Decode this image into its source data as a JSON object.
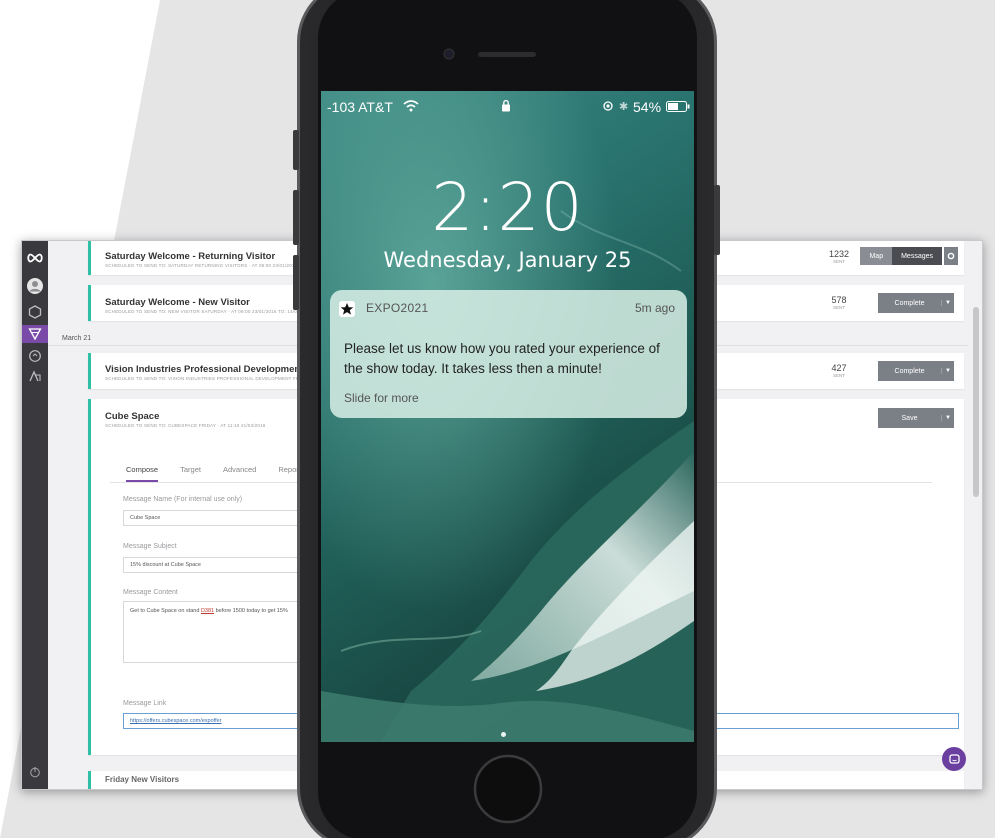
{
  "sidebar": {
    "logo_icon": "infinity-logo-icon",
    "items": [
      {
        "icon": "user-avatar-icon",
        "active": false
      },
      {
        "icon": "hexagon-icon",
        "active": false
      },
      {
        "icon": "triangle-filter-icon",
        "active": true
      },
      {
        "icon": "refresh-circle-icon",
        "active": false
      },
      {
        "icon": "people-icon",
        "active": false
      }
    ],
    "bottom_icon": "power-icon"
  },
  "messages": [
    {
      "title": "Saturday Welcome - Returning Visitor",
      "subtitle": "SCHEDULED TO SEND TO: SATURDAY RETURNING VISITORS · AT 09:00 23/01/2016 TO: 14/0",
      "sent_count": "1232",
      "sent_label": "SENT",
      "map_label": "Map",
      "messages_label": "Messages"
    },
    {
      "title": "Saturday Welcome - New Visitor",
      "subtitle": "SCHEDULED TO SEND TO: NEW VISITOR SATURDAY · AT 09:00 23/01/2016 TO: 14/0",
      "sent_count": "578",
      "sent_label": "SENT",
      "button_label": "Complete"
    }
  ],
  "date_header": "March 21",
  "messages2": [
    {
      "title": "Vision Industries Professional Development South Hal",
      "subtitle": "SCHEDULED TO SEND TO: VISION INDUSTRIES PROFESSIONAL DEVELOPMENT FRIDAY · AT 1",
      "sent_count": "427",
      "sent_label": "SENT",
      "button_label": "Complete"
    }
  ],
  "editor": {
    "title": "Cube Space",
    "subtitle": "SCHEDULED TO SEND TO: CUBESPACE FRIDAY · AT 11:10 21/03/2018",
    "save_label": "Save",
    "tabs": [
      "Compose",
      "Target",
      "Advanced",
      "Report"
    ],
    "active_tab": "Compose",
    "name_label": "Message Name (For internal use only)",
    "name_value": "Cube Space",
    "subject_label": "Message Subject",
    "subject_value": "15% discount at Cube Space",
    "content_label": "Message Content",
    "content_value_pre": "Get to Cube Space on stand ",
    "content_link": "D381",
    "content_value_post": " before 1500 today to get 15%",
    "link_label": "Message Link",
    "link_value": "https://offers.cubespace.com/expoffer"
  },
  "next_item_title": "Friday New Visitors",
  "phone": {
    "carrier": "-103 AT&T",
    "battery": "54%",
    "time": "2:20",
    "date": "Wednesday, January 25",
    "notification": {
      "app": "EXPO2021",
      "time": "5m ago",
      "body": "Please let us know how you rated your experience of the show today. It takes less then a minute!",
      "action": "Slide for more"
    }
  },
  "colors": {
    "accent": "#7a4aa8",
    "card_edge": "#2fbfa5",
    "rail": "#3a3a3e",
    "button": "#7b7f86"
  }
}
